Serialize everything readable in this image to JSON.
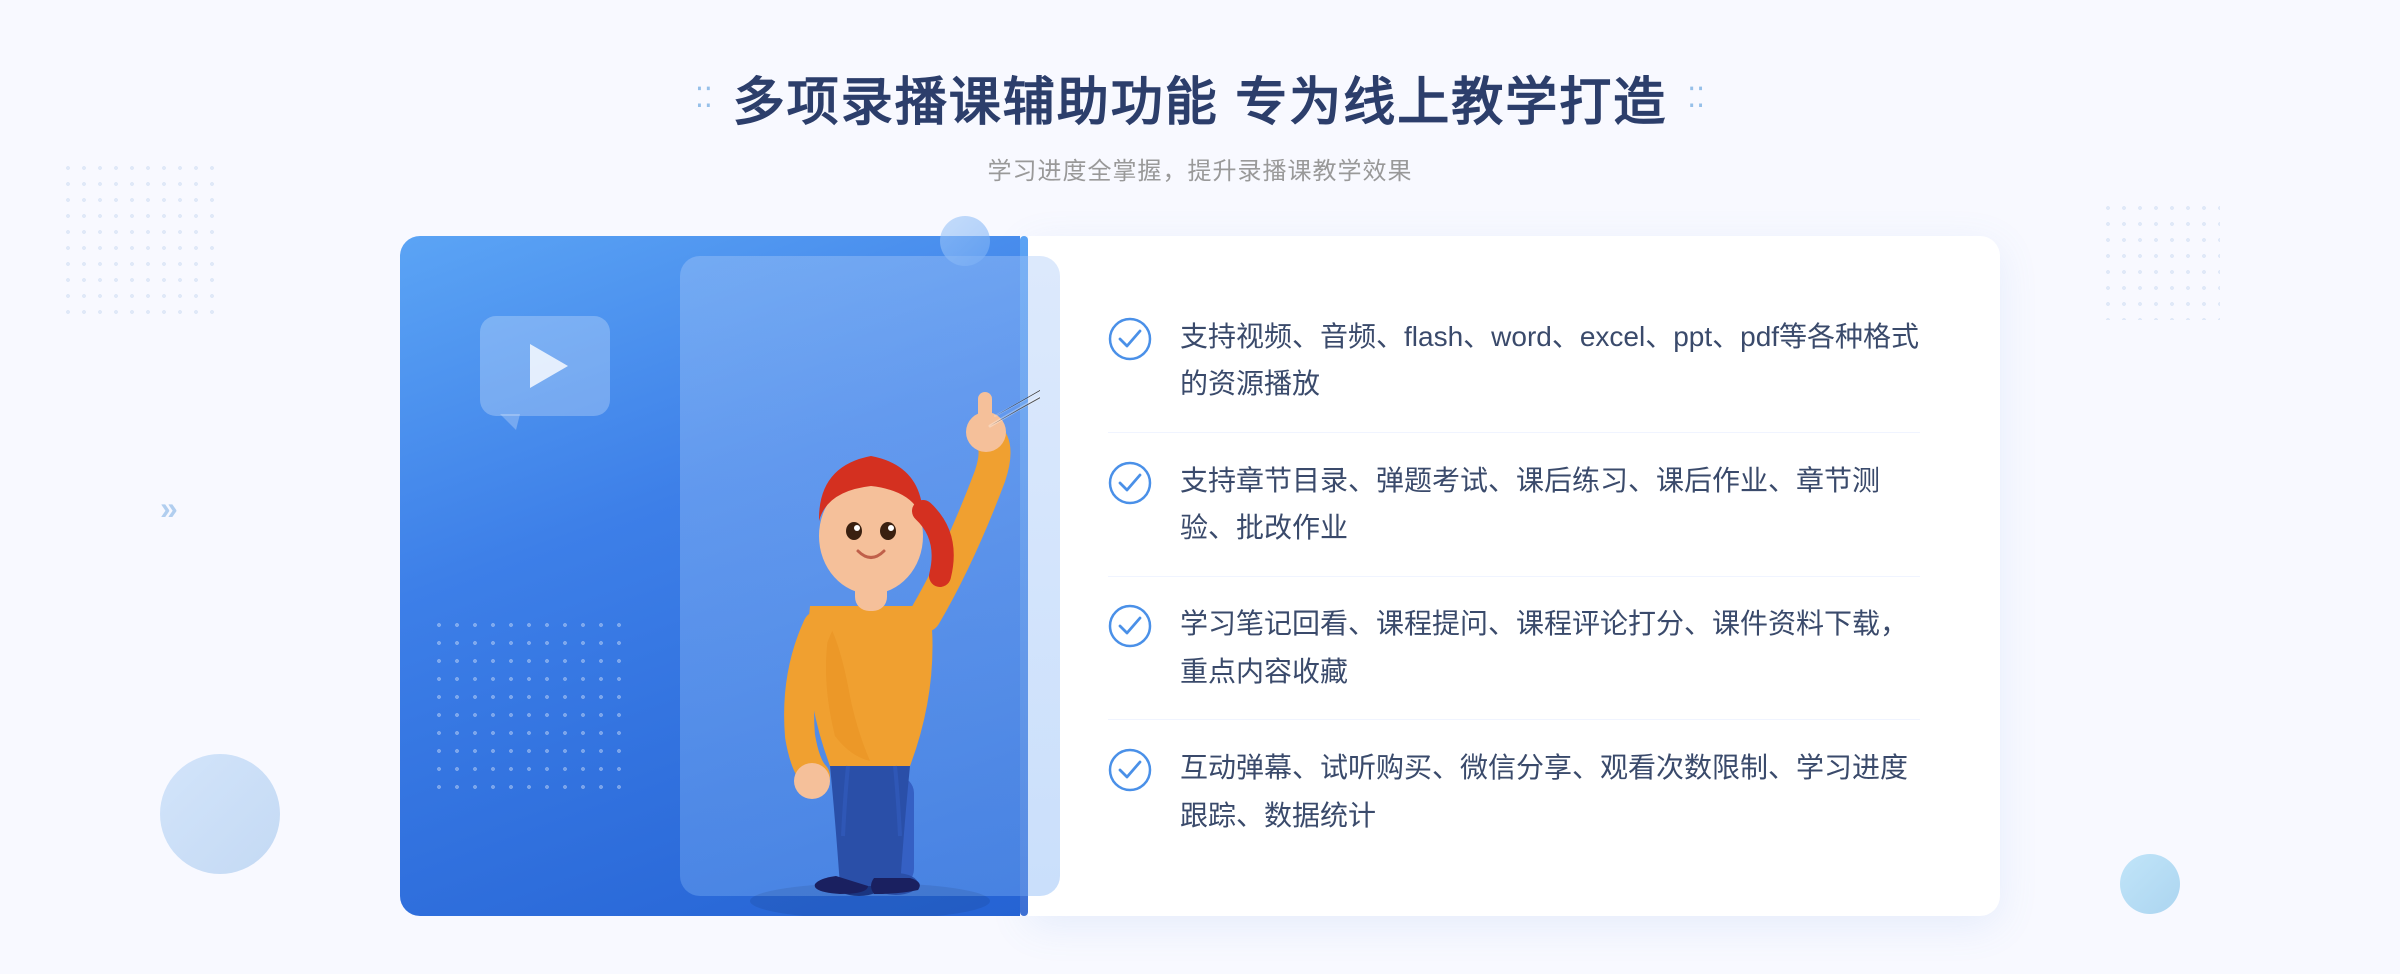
{
  "header": {
    "title": "多项录播课辅助功能 专为线上教学打造",
    "subtitle": "学习进度全掌握，提升录播课教学效果",
    "dots_icon_left": "·: ·:",
    "dots_icon_right": "·: ·:"
  },
  "features": [
    {
      "id": 1,
      "text": "支持视频、音频、flash、word、excel、ppt、pdf等各种格式的资源播放"
    },
    {
      "id": 2,
      "text": "支持章节目录、弹题考试、课后练习、课后作业、章节测验、批改作业"
    },
    {
      "id": 3,
      "text": "学习笔记回看、课程提问、课程评论打分、课件资料下载，重点内容收藏"
    },
    {
      "id": 4,
      "text": "互动弹幕、试听购买、微信分享、观看次数限制、学习进度跟踪、数据统计"
    }
  ],
  "colors": {
    "accent_blue": "#4a90e8",
    "title_dark": "#2c3e6b",
    "text_body": "#3a4a6b",
    "subtitle_gray": "#999999",
    "check_color": "#4a90e8"
  },
  "decorations": {
    "chevron_arrows": "»",
    "play_icon": "▶"
  }
}
